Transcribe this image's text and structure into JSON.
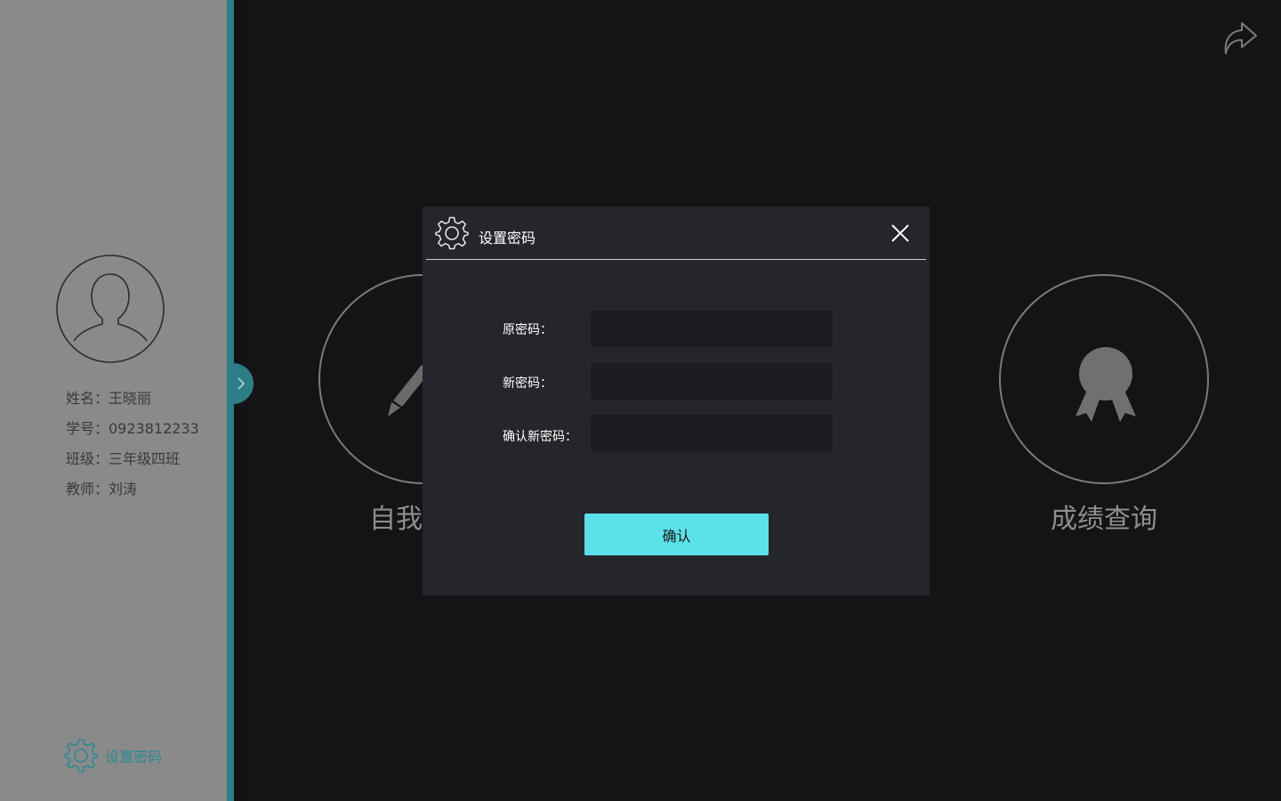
{
  "sidebar": {
    "profile": {
      "name_label": "姓名：王晓丽",
      "student_id_label": "学号：0923812233",
      "class_label": "班级：三年级四班",
      "teacher_label": "教师：刘涛"
    },
    "settings_label": "设置密码",
    "accent_color": "#2c7d86",
    "icons": {
      "avatar": "user-avatar-icon",
      "settings": "gear-icon",
      "toggle": "chevron-right-icon"
    }
  },
  "main": {
    "modules": [
      {
        "label": "自我",
        "icon": "pencil-icon"
      },
      {
        "label": "成绩查询",
        "icon": "award-ribbon-icon"
      }
    ],
    "share_icon": "share-arrow-icon"
  },
  "dialog": {
    "title": "设置密码",
    "fields": [
      {
        "label": "原密码：",
        "value": "",
        "placeholder": ""
      },
      {
        "label": "新密码：",
        "value": "",
        "placeholder": ""
      },
      {
        "label": "确认新密码：",
        "value": "",
        "placeholder": ""
      }
    ],
    "confirm_label": "确认",
    "confirm_color": "#5ce1ea",
    "icons": {
      "header": "gear-icon",
      "close": "close-icon"
    }
  }
}
